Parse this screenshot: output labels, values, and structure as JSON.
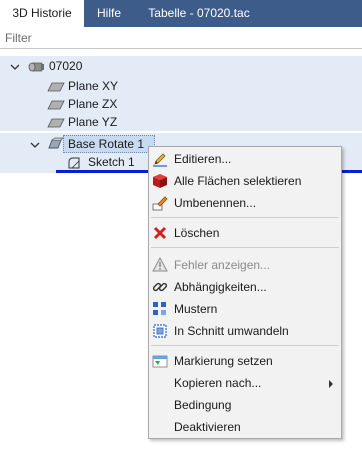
{
  "tabs": [
    {
      "label": "3D Historie",
      "active": true
    },
    {
      "label": "Hilfe",
      "active": false
    },
    {
      "label": "Tabelle - 07020.tac",
      "active": false
    }
  ],
  "filter": {
    "placeholder": "Filter",
    "value": ""
  },
  "tree": {
    "root": {
      "label": "07020",
      "expanded": true,
      "children": [
        {
          "label": "Plane XY"
        },
        {
          "label": "Plane ZX"
        },
        {
          "label": "Plane YZ"
        }
      ]
    },
    "feature": {
      "label": "Base Rotate 1",
      "expanded": true,
      "children": [
        {
          "label": "Sketch 1"
        }
      ]
    }
  },
  "context_menu": {
    "items": [
      {
        "label": "Editieren...",
        "icon": "pencil-icon"
      },
      {
        "label": "Alle Flächen selektieren",
        "icon": "red-cube-icon"
      },
      {
        "label": "Umbenennen...",
        "icon": "rename-pencil-icon"
      },
      {
        "label": "Löschen",
        "icon": "red-x-icon"
      },
      {
        "label": "Fehler anzeigen...",
        "icon": "warning-icon",
        "disabled": true
      },
      {
        "label": "Abhängigkeiten...",
        "icon": "chain-link-icon"
      },
      {
        "label": "Mustern",
        "icon": "pattern-icon"
      },
      {
        "label": "In Schnitt umwandeln",
        "icon": "section-icon"
      },
      {
        "label": "Markierung setzen",
        "icon": "marker-icon"
      },
      {
        "label": "Kopieren nach...",
        "icon": "",
        "submenu": true
      },
      {
        "label": "Bedingung",
        "icon": ""
      },
      {
        "label": "Deaktivieren",
        "icon": ""
      }
    ]
  },
  "colors": {
    "tabbar": "#3e5c8a",
    "tree_highlight": "#e3ecf6",
    "selection": "#c7daf0",
    "active_line": "#0a1ed2",
    "menu_bg": "#f2f2f2"
  }
}
